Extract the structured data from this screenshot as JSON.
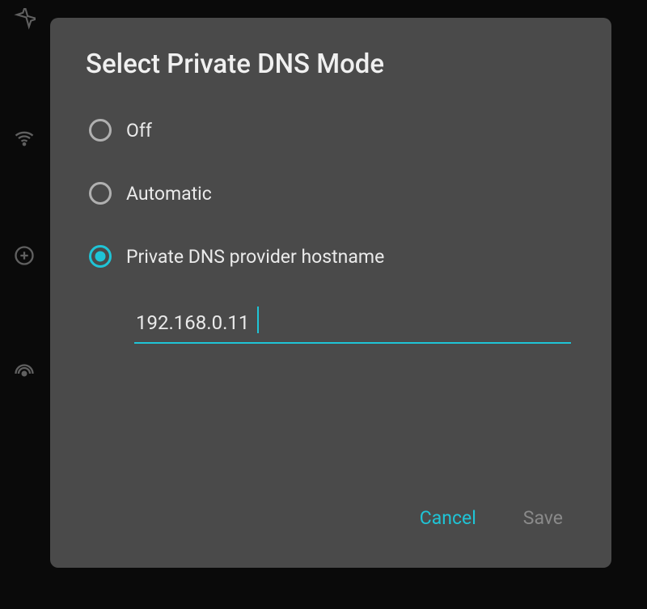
{
  "dialog": {
    "title": "Select Private DNS Mode",
    "options": {
      "off": "Off",
      "automatic": "Automatic",
      "hostname": "Private DNS provider hostname"
    },
    "selected": "hostname",
    "hostname_value": "192.168.0.11",
    "actions": {
      "cancel": "Cancel",
      "save": "Save"
    }
  },
  "colors": {
    "accent": "#1fc4d6",
    "dialog_bg": "#4a4a4a",
    "page_bg": "#0a0a0a"
  }
}
